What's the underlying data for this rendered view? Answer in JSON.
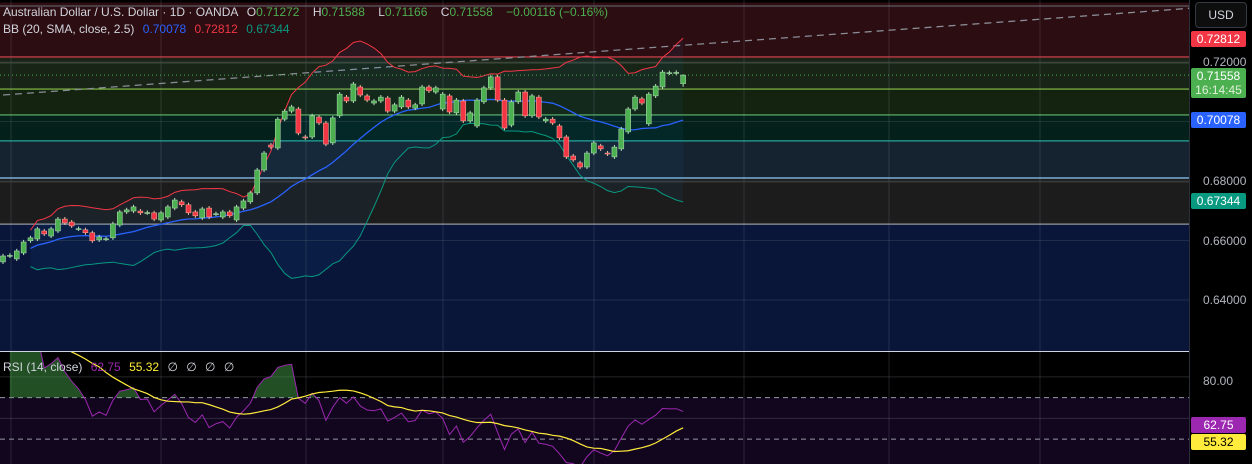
{
  "header": {
    "symbol": "Australian Dollar / U.S. Dollar · 1D · OANDA",
    "o_label": "O",
    "o": "0.71272",
    "h_label": "H",
    "h": "0.71588",
    "l_label": "L",
    "l": "0.71166",
    "c_label": "C",
    "c": "0.71558",
    "change": "−0.00116 (−0.16%)"
  },
  "bb_legend": {
    "label": "BB (20, SMA, close, 2.5)",
    "basis": "0.70078",
    "upper": "0.72812",
    "lower": "0.67344"
  },
  "rsi_legend": {
    "label": "RSI (14, close)",
    "rsi": "62.75",
    "ma": "55.32",
    "extras": [
      "∅",
      "∅",
      "∅",
      "∅"
    ]
  },
  "axis": {
    "currency": "USD",
    "ticks": [
      "0.72000",
      "0.68000",
      "0.66000",
      "0.64000"
    ],
    "rsi_ticks": [
      "80.00"
    ],
    "tags": {
      "upper": "0.72812",
      "price": "0.71558",
      "countdown": "16:14:45",
      "basis": "0.70078",
      "lower": "0.67344",
      "rsi": "62.75",
      "rsi_ma": "55.32"
    }
  },
  "colors": {
    "up": "#4caf50",
    "down": "#f23645",
    "basis": "#2962ff",
    "upper": "#f23645",
    "lower": "#089981",
    "rsi": "#9c27b0",
    "rsi_ma": "#ffeb3b"
  },
  "chart_data": {
    "type": "candlestick",
    "title": "Australian Dollar / U.S. Dollar · 1D · OANDA",
    "ylim": [
      0.6235,
      0.7378
    ],
    "yticks": [
      0.72,
      0.7,
      0.68,
      0.66,
      0.64
    ],
    "last_bar": {
      "open": 0.71272,
      "high": 0.71588,
      "low": 0.71166,
      "close": 0.71558
    },
    "candles_oc": [
      [
        0.6528,
        0.6548
      ],
      [
        0.6548,
        0.655
      ],
      [
        0.6538,
        0.6565
      ],
      [
        0.6558,
        0.6595
      ],
      [
        0.6599,
        0.6609
      ],
      [
        0.6605,
        0.6639
      ],
      [
        0.6632,
        0.6622
      ],
      [
        0.6615,
        0.6639
      ],
      [
        0.6632,
        0.6672
      ],
      [
        0.6672,
        0.6659
      ],
      [
        0.6662,
        0.6649
      ],
      [
        0.6639,
        0.664
      ],
      [
        0.6636,
        0.6626
      ],
      [
        0.6626,
        0.6599
      ],
      [
        0.6602,
        0.6612
      ],
      [
        0.6605,
        0.6606
      ],
      [
        0.6609,
        0.6656
      ],
      [
        0.6652,
        0.6696
      ],
      [
        0.6696,
        0.6703
      ],
      [
        0.6699,
        0.6713
      ],
      [
        0.6699,
        0.6693
      ],
      [
        0.6693,
        0.6694
      ],
      [
        0.6693,
        0.6672
      ],
      [
        0.6669,
        0.6693
      ],
      [
        0.6679,
        0.6713
      ],
      [
        0.6709,
        0.6736
      ],
      [
        0.673,
        0.672
      ],
      [
        0.672,
        0.6693
      ],
      [
        0.6696,
        0.6683
      ],
      [
        0.6676,
        0.6706
      ],
      [
        0.6709,
        0.6679
      ],
      [
        0.6689,
        0.669
      ],
      [
        0.6679,
        0.6696
      ],
      [
        0.6696,
        0.6683
      ],
      [
        0.6669,
        0.6713
      ],
      [
        0.6709,
        0.6733
      ],
      [
        0.673,
        0.676
      ],
      [
        0.676,
        0.6837
      ],
      [
        0.6837,
        0.6894
      ],
      [
        0.6921,
        0.6914
      ],
      [
        0.6911,
        0.7008
      ],
      [
        0.7008,
        0.7035
      ],
      [
        0.7035,
        0.7049
      ],
      [
        0.7042,
        0.6961
      ],
      [
        0.6948,
        0.6945
      ],
      [
        0.6948,
        0.7019
      ],
      [
        0.7015,
        0.6995
      ],
      [
        0.6995,
        0.6924
      ],
      [
        0.6928,
        0.7012
      ],
      [
        0.7019,
        0.7092
      ],
      [
        0.7082,
        0.7069
      ],
      [
        0.7069,
        0.7126
      ],
      [
        0.7116,
        0.7089
      ],
      [
        0.7086,
        0.7072
      ],
      [
        0.7062,
        0.7069
      ],
      [
        0.7069,
        0.7082
      ],
      [
        0.7079,
        0.7035
      ],
      [
        0.7035,
        0.7056
      ],
      [
        0.7049,
        0.7082
      ],
      [
        0.7072,
        0.7049
      ],
      [
        0.7045,
        0.7056
      ],
      [
        0.7059,
        0.7116
      ],
      [
        0.7116,
        0.7103
      ],
      [
        0.7099,
        0.7113
      ],
      [
        0.7042,
        0.7092
      ],
      [
        0.7086,
        0.7032
      ],
      [
        0.7029,
        0.7072
      ],
      [
        0.7069,
        0.7002
      ],
      [
        0.7002,
        0.7029
      ],
      [
        0.6985,
        0.7072
      ],
      [
        0.7066,
        0.7113
      ],
      [
        0.7113,
        0.715
      ],
      [
        0.715,
        0.7072
      ],
      [
        0.7072,
        0.6978
      ],
      [
        0.6988,
        0.7066
      ],
      [
        0.7066,
        0.7099
      ],
      [
        0.7099,
        0.7019
      ],
      [
        0.7019,
        0.7086
      ],
      [
        0.7082,
        0.7015
      ],
      [
        0.7002,
        0.7008
      ],
      [
        0.7008,
        0.6995
      ],
      [
        0.6985,
        0.6945
      ],
      [
        0.6948,
        0.6881
      ],
      [
        0.6884,
        0.6871
      ],
      [
        0.6861,
        0.6847
      ],
      [
        0.6847,
        0.6894
      ],
      [
        0.6894,
        0.6928
      ],
      [
        0.6918,
        0.6908
      ],
      [
        0.6894,
        0.6891
      ],
      [
        0.6881,
        0.6914
      ],
      [
        0.6908,
        0.6975
      ],
      [
        0.6965,
        0.7042
      ],
      [
        0.7042,
        0.7082
      ],
      [
        0.7076,
        0.7062
      ],
      [
        0.6992,
        0.7092
      ],
      [
        0.7086,
        0.7119
      ],
      [
        0.7116,
        0.7166
      ],
      [
        0.7163,
        0.7164
      ],
      [
        0.7163,
        0.7165
      ],
      [
        0.71272,
        0.71558
      ]
    ],
    "zones": [
      {
        "top": 0.74,
        "bottom": 0.7217,
        "color": "#2c0d11"
      },
      {
        "top": 0.7217,
        "bottom": 0.7197,
        "color": "#1b2217"
      },
      {
        "top": 0.7197,
        "bottom": 0.7109,
        "color": "#182516"
      },
      {
        "top": 0.7109,
        "bottom": 0.7022,
        "color": "#13230f"
      },
      {
        "top": 0.7022,
        "bottom": 0.6935,
        "color": "#03201b"
      },
      {
        "top": 0.6935,
        "bottom": 0.681,
        "color": "#152330"
      },
      {
        "top": 0.681,
        "bottom": 0.6655,
        "color": "#1c1c1c"
      },
      {
        "top": 0.6655,
        "bottom": 0.62,
        "color": "#09163a"
      }
    ],
    "levels": [
      {
        "price": 0.7217,
        "color": "#e0424f"
      },
      {
        "price": 0.7197,
        "color": "#3a4a3a"
      },
      {
        "price": 0.7109,
        "color": "#8bc34a"
      },
      {
        "price": 0.7022,
        "color": "#66bb6a"
      },
      {
        "price": 0.6935,
        "color": "#26a69a"
      },
      {
        "price": 0.681,
        "color": "#90caf9"
      },
      {
        "price": 0.6797,
        "color": "#3a3a3a"
      },
      {
        "price": 0.6655,
        "color": "#9598a1"
      }
    ],
    "trendline": {
      "from": [
        0,
        0.7089
      ],
      "to": [
        173,
        0.7381
      ]
    },
    "bb": {
      "length": 20,
      "mult": 2.5
    },
    "rsi": {
      "length": 14,
      "ma_length": 14,
      "ylim": [
        38,
        92
      ],
      "bands": [
        70,
        50
      ]
    }
  }
}
